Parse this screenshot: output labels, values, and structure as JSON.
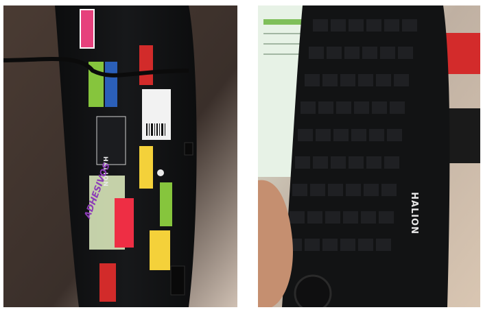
{
  "images": {
    "left": {
      "brand": "HALION",
      "handwritten_label": "ADHESIVOS"
    },
    "right": {
      "brand": "HALION"
    }
  },
  "colors": {
    "keyboard_body": "#121314",
    "background_left": "#3a2f2a",
    "background_right": "#c9b6a4",
    "sticker_pink": "#e6417c",
    "sticker_red": "#d22b2a",
    "sticker_yellow": "#f4d13a",
    "sticker_green": "#86c53d",
    "sticker_blue": "#2b5fb8"
  }
}
